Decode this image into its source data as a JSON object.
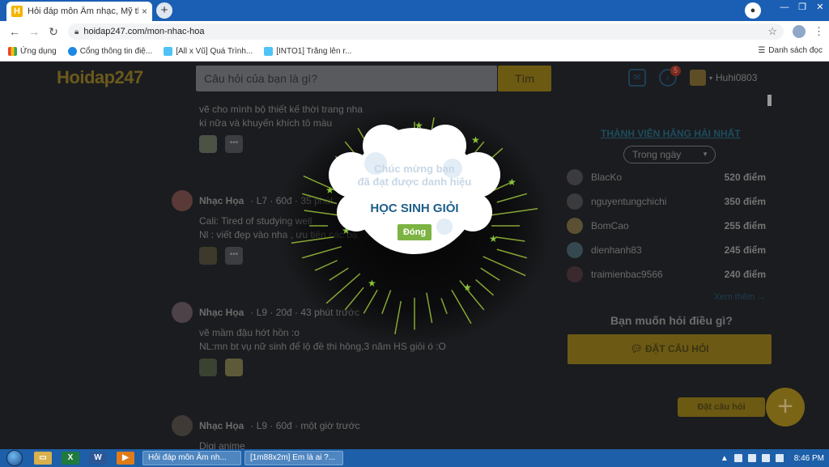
{
  "browser": {
    "tab_title": "Hỏi đáp môn Âm nhạc, Mỹ thuật",
    "tab_close": "×",
    "new_tab": "+",
    "url": "hoidap247.com/mon-nhac-hoa",
    "bookmarks": [
      "Ứng dụng",
      "Cổng thông tin điệ...",
      "[All x Vũ] Quá Trình...",
      "[INTO1] Trăng lên r..."
    ],
    "reading_list": "Danh sách đọc"
  },
  "site": {
    "logo": "Hoidap247",
    "search_placeholder": "Câu hỏi của bạn là gì?",
    "search_button": "Tìm",
    "notif_count": "5",
    "username": "Huhi0803"
  },
  "posts": [
    {
      "name": "",
      "meta": "",
      "body": [
        "vẽ cho mình bộ thiết kế thời trang nha",
        "kí nữa và khuyến khích tô màu"
      ],
      "more": "•••"
    },
    {
      "name": "Nhạc Họa",
      "meta": "· L7 · 60đ · 35 phút",
      "body": [
        "Cali: Tired of studying well",
        "Nl :  viết đẹp vào nha , ưu tiên các bạ"
      ],
      "more": "•••"
    },
    {
      "name": "Nhạc Họa",
      "meta": "· L9 · 20đ · 43 phút trước",
      "body": [
        "vẽ mầm đậu hớt hồn :o",
        "NL:mn bt vụ nữ sinh để lộ đề thi hông,3 năm HS giỏi ó :O"
      ],
      "more": ""
    },
    {
      "name": "Nhạc Họa",
      "meta": "· L9 · 60đ · một giờ trước",
      "body": [
        "Digi anime"
      ],
      "more": ""
    }
  ],
  "sidebar": {
    "title": "THÀNH VIÊN HĂNG HÁI NHẤT",
    "period": "Trong ngày",
    "ranking": [
      {
        "name": "BlacKo",
        "points": "520 điểm"
      },
      {
        "name": "nguyentungchichi",
        "points": "350 điểm"
      },
      {
        "name": "BomCao",
        "points": "255 điểm"
      },
      {
        "name": "dienhanh83",
        "points": "245 điểm"
      },
      {
        "name": "traimienbac9566",
        "points": "240 điểm"
      }
    ],
    "more": "Xem thêm →",
    "ask_heading": "Bạn muốn hỏi điều gì?",
    "ask_button": "ĐẶT CÂU HỎI",
    "fab_label": "Đặt câu hỏi",
    "fab_icon": "+"
  },
  "modal": {
    "line1": "Chúc mừng bạn",
    "line2": "đã đạt được danh hiệu",
    "award": "HỌC SINH GIỎI",
    "close": "Đóng"
  },
  "taskbar": {
    "windows": [
      "Hỏi đáp môn Âm nh...",
      "[1m88x2m] Em là ai ?..."
    ],
    "clock": "8:46 PM"
  }
}
